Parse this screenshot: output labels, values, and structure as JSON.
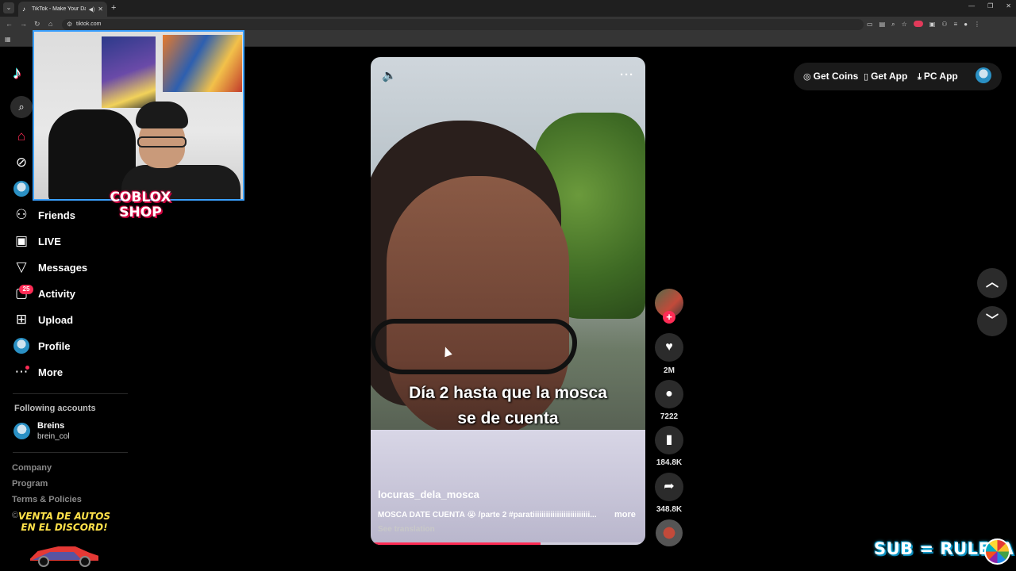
{
  "browser": {
    "tab_title": "TikTok - Make Your Day",
    "url": "tiktok.com",
    "new_tab_symbol": "+",
    "tab_close_symbol": "✕"
  },
  "sidebar": {
    "items": [
      {
        "label": "Friends",
        "icon": "friends-icon"
      },
      {
        "label": "LIVE",
        "icon": "live-icon"
      },
      {
        "label": "Messages",
        "icon": "messages-icon"
      },
      {
        "label": "Activity",
        "icon": "activity-icon",
        "badge": "25"
      },
      {
        "label": "Upload",
        "icon": "upload-icon"
      },
      {
        "label": "Profile",
        "icon": "profile-avatar"
      },
      {
        "label": "More",
        "icon": "more-icon"
      }
    ],
    "following_header": "Following accounts",
    "following": [
      {
        "name": "Breins",
        "handle": "brein_col"
      }
    ],
    "footer_links": [
      "Company",
      "Program",
      "Terms & Policies"
    ],
    "footer_copy": "©"
  },
  "overlay": {
    "shop_text_line1": "COBLOX",
    "shop_text_line2": "SHOP",
    "venta_line1": "VENTA DE AUTOS",
    "venta_line2": "EN EL DISCORD!",
    "sub_ruleta": "SUB = RULETA"
  },
  "video": {
    "caption_line1": "Día 2 hasta que la mosca",
    "caption_line2": "se de cuenta",
    "username": "locuras_dela_mosca",
    "description": "MOSCA DATE CUENTA 😭 /parte 2 #paratiiiiiiiiiiiiiiiiiiiiiiiiii...",
    "more_label": "more",
    "see_translation": "See translation",
    "progress_fraction": 0.62
  },
  "actions": {
    "follow_symbol": "+",
    "likes": "2M",
    "comments": "7222",
    "saves": "184.8K",
    "shares": "348.8K"
  },
  "topbar": {
    "get_coins": "Get Coins",
    "get_app": "Get App",
    "pc_app": "PC App"
  },
  "colors": {
    "accent": "#fe2c55",
    "background": "#000000",
    "webcam_border": "#3aa0ff"
  }
}
